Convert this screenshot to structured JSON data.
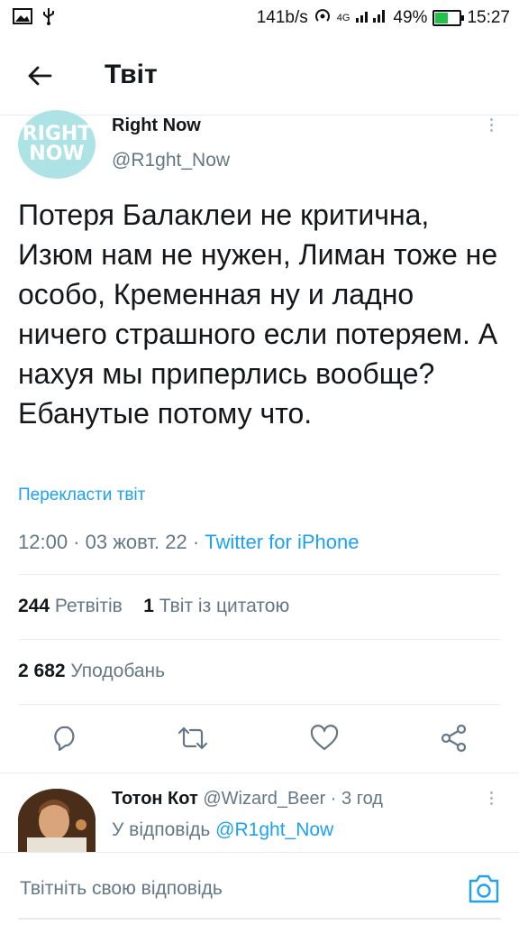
{
  "status_bar": {
    "speed": "141b/s",
    "network": "4G",
    "battery": "49%",
    "battery_level": 0.49,
    "time": "15:27"
  },
  "header": {
    "back_icon": "arrow-left-icon",
    "title": "Твіт"
  },
  "tweet": {
    "avatar_text_1": "RIGHT",
    "avatar_text_2": "NOW",
    "name": "Right Now",
    "handle": "@R1ght_Now",
    "text": "Потеря Балаклеи не критична, Изюм нам не нужен, Лиман тоже не особо, Кременная ну и ладно ничего страшного если потеряем. А нахуя мы приперлись вообще? Ебанутые потому что.",
    "translate_link": "Перекласти твіт",
    "time": "12:00",
    "date": "03 жовт. 22",
    "source": "Twitter for iPhone",
    "dot": " · ",
    "retweets_count": "244",
    "retweets_label": "Ретвітів",
    "quotes_count": "1",
    "quotes_label": "Твіт із цитатою",
    "likes_count": "2 682",
    "likes_label": "Уподобань"
  },
  "actions": [
    {
      "icon": "reply-icon"
    },
    {
      "icon": "retweet-icon"
    },
    {
      "icon": "heart-icon"
    },
    {
      "icon": "share-icon"
    }
  ],
  "reply": {
    "name": "Тотон Кот",
    "handle": "@Wizard_Beer",
    "age": "3 год",
    "replying_to_prefix": "У відповідь",
    "replying_to": "@R1ght_Now"
  },
  "compose": {
    "placeholder": "Твітніть свою відповідь",
    "camera_icon": "camera-icon"
  },
  "colors": {
    "accent": "#1da1f2",
    "secondary_text": "#657786",
    "divider": "#e6ecf0"
  }
}
